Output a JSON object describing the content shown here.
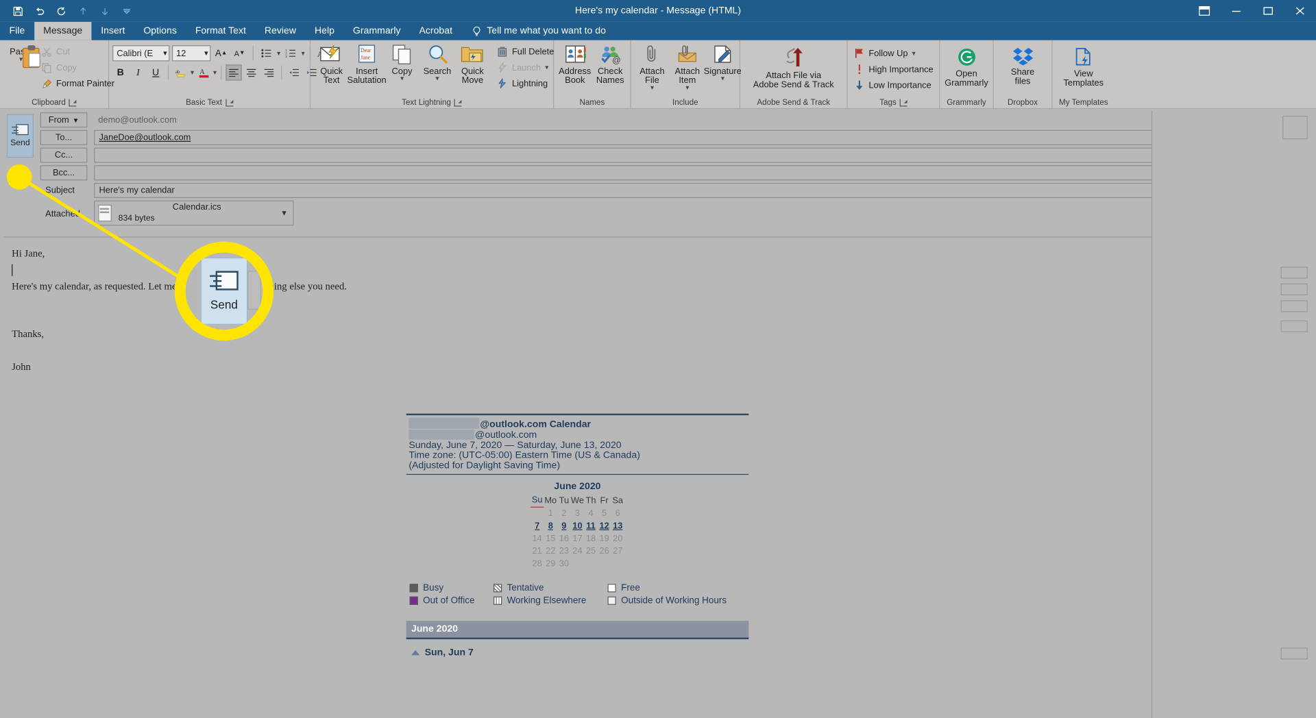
{
  "window": {
    "title": "Here's my calendar  -  Message (HTML)",
    "quick_access": [
      {
        "name": "save-icon",
        "glyph": "💾",
        "dim": false
      },
      {
        "name": "undo-icon",
        "glyph": "↶",
        "dim": false
      },
      {
        "name": "redo-icon",
        "glyph": "↻",
        "dim": false
      },
      {
        "name": "previous-item-icon",
        "glyph": "↑",
        "dim": true
      },
      {
        "name": "next-item-icon",
        "glyph": "↓",
        "dim": true
      },
      {
        "name": "customize-quick-access-icon",
        "glyph": "⌄",
        "dim": true
      }
    ],
    "controls": {
      "ribbon_display_options": "▣",
      "minimize": "─",
      "maximize": "□",
      "close": "✕"
    }
  },
  "tabs": [
    {
      "label": "File",
      "active": false
    },
    {
      "label": "Message",
      "active": true
    },
    {
      "label": "Insert",
      "active": false
    },
    {
      "label": "Options",
      "active": false
    },
    {
      "label": "Format Text",
      "active": false
    },
    {
      "label": "Review",
      "active": false
    },
    {
      "label": "Help",
      "active": false
    },
    {
      "label": "Grammarly",
      "active": false
    },
    {
      "label": "Acrobat",
      "active": false
    }
  ],
  "tell_me": "Tell me what you want to do",
  "ribbon": {
    "groups": [
      {
        "label": "Clipboard",
        "has_launcher": true
      },
      {
        "label": "Basic Text",
        "has_launcher": true
      },
      {
        "label": "Text Lightning",
        "has_launcher": true
      },
      {
        "label": "Names",
        "has_launcher": false
      },
      {
        "label": "Include",
        "has_launcher": false
      },
      {
        "label": "Adobe Send & Track",
        "has_launcher": false
      },
      {
        "label": "Tags",
        "has_launcher": true
      },
      {
        "label": "Grammarly",
        "has_launcher": false
      },
      {
        "label": "Dropbox",
        "has_launcher": false
      },
      {
        "label": "My Templates",
        "has_launcher": false
      }
    ],
    "clipboard": {
      "paste": "Paste",
      "cut": "Cut",
      "copy": "Copy",
      "format_painter": "Format Painter"
    },
    "basic_text": {
      "font_name": "Calibri (E",
      "font_size": "12",
      "grow_font": "A",
      "shrink_font": "A",
      "bold": "B",
      "italic": "I",
      "underline": "U",
      "highlight": "ab",
      "font_color": "A",
      "bullets": "•≡",
      "numbering": "1≡",
      "clear_formatting": "A"
    },
    "text_lightning": {
      "quick_text": "Quick\nText",
      "insert_salutation": "Insert\nSalutation",
      "salutation_badge": "Dear\nJane",
      "copy": "Copy",
      "search": "Search",
      "quick_move": "Quick\nMove",
      "full_delete": "Full Delete",
      "launch": "Launch",
      "lightning": "Lightning"
    },
    "names": {
      "address_book": "Address\nBook",
      "check_names": "Check\nNames"
    },
    "include": {
      "attach_file": "Attach\nFile",
      "attach_item": "Attach\nItem",
      "signature": "Signature"
    },
    "adobe": {
      "attach_file_via": "Attach File via\nAdobe Send & Track"
    },
    "tags": {
      "follow_up": "Follow Up",
      "high_importance": "High Importance",
      "low_importance": "Low Importance"
    },
    "grammarly": {
      "open_grammarly": "Open\nGrammarly"
    },
    "dropbox": {
      "share_files": "Share\nfiles"
    },
    "my_templates": {
      "view_templates": "View\nTemplates"
    }
  },
  "compose": {
    "send_button": "Send",
    "from_label": "From",
    "from_value": "demo@outlook.com",
    "to_label": "To...",
    "to_value": "JaneDoe@outlook.com",
    "cc_label": "Cc...",
    "cc_value": "",
    "bcc_label": "Bcc...",
    "bcc_value": "",
    "subject_label": "Subject",
    "subject_value": "Here's my calendar",
    "attached_label": "Attached",
    "attachment_name": "Calendar.ics",
    "attachment_size": "834 bytes"
  },
  "body": {
    "greeting": "Hi Jane,",
    "paragraph": "Here's my calendar, as requested. Let me know if you need anything else you need.",
    "closing": "Thanks,",
    "signature": "John"
  },
  "calendar_preview": {
    "owner_line": "@outlook.com Calendar",
    "email_line": "@outlook.com",
    "date_range": "Sunday, June 7, 2020 — Saturday, June 13, 2020",
    "time_zone": "Time zone: (UTC-05:00) Eastern Time (US & Canada)",
    "dst_note": "(Adjusted for Daylight Saving Time)",
    "month_title": "June 2020",
    "weekday_headers": [
      "Su",
      "Mo",
      "Tu",
      "We",
      "Th",
      "Fr",
      "Sa"
    ],
    "weeks": [
      [
        {
          "d": "",
          "hl": false
        },
        {
          "d": "1",
          "hl": false
        },
        {
          "d": "2",
          "hl": false
        },
        {
          "d": "3",
          "hl": false
        },
        {
          "d": "4",
          "hl": false
        },
        {
          "d": "5",
          "hl": false
        },
        {
          "d": "6",
          "hl": false
        }
      ],
      [
        {
          "d": "7",
          "hl": true
        },
        {
          "d": "8",
          "hl": true
        },
        {
          "d": "9",
          "hl": true
        },
        {
          "d": "10",
          "hl": true
        },
        {
          "d": "11",
          "hl": true
        },
        {
          "d": "12",
          "hl": true
        },
        {
          "d": "13",
          "hl": true
        }
      ],
      [
        {
          "d": "14",
          "hl": false
        },
        {
          "d": "15",
          "hl": false
        },
        {
          "d": "16",
          "hl": false
        },
        {
          "d": "17",
          "hl": false
        },
        {
          "d": "18",
          "hl": false
        },
        {
          "d": "19",
          "hl": false
        },
        {
          "d": "20",
          "hl": false
        }
      ],
      [
        {
          "d": "21",
          "hl": false
        },
        {
          "d": "22",
          "hl": false
        },
        {
          "d": "23",
          "hl": false
        },
        {
          "d": "24",
          "hl": false
        },
        {
          "d": "25",
          "hl": false
        },
        {
          "d": "26",
          "hl": false
        },
        {
          "d": "27",
          "hl": false
        }
      ],
      [
        {
          "d": "28",
          "hl": false
        },
        {
          "d": "29",
          "hl": false
        },
        {
          "d": "30",
          "hl": false
        },
        {
          "d": "",
          "hl": false
        },
        {
          "d": "",
          "hl": false
        },
        {
          "d": "",
          "hl": false
        },
        {
          "d": "",
          "hl": false
        }
      ]
    ],
    "legend": [
      {
        "label": "Busy",
        "style": "sw-busy"
      },
      {
        "label": "Tentative",
        "style": "sw-tent"
      },
      {
        "label": "Free",
        "style": "sw-free"
      },
      {
        "label": "Out of Office",
        "style": "sw-ooo"
      },
      {
        "label": "Working Elsewhere",
        "style": "sw-work"
      },
      {
        "label": "Outside of Working Hours",
        "style": "sw-out"
      }
    ],
    "month_bar": "June 2020",
    "first_day": "Sun, Jun 7"
  },
  "callout": {
    "magnified_label": "Send"
  },
  "colors": {
    "title_bar": "#1f5c8b",
    "ribbon": "#c8c6c4",
    "window_body": "#b8b8b8",
    "highlight_yellow": "#ffe400",
    "calendar_navy": "#1f3a5c",
    "month_bar": "#8b93a3"
  }
}
